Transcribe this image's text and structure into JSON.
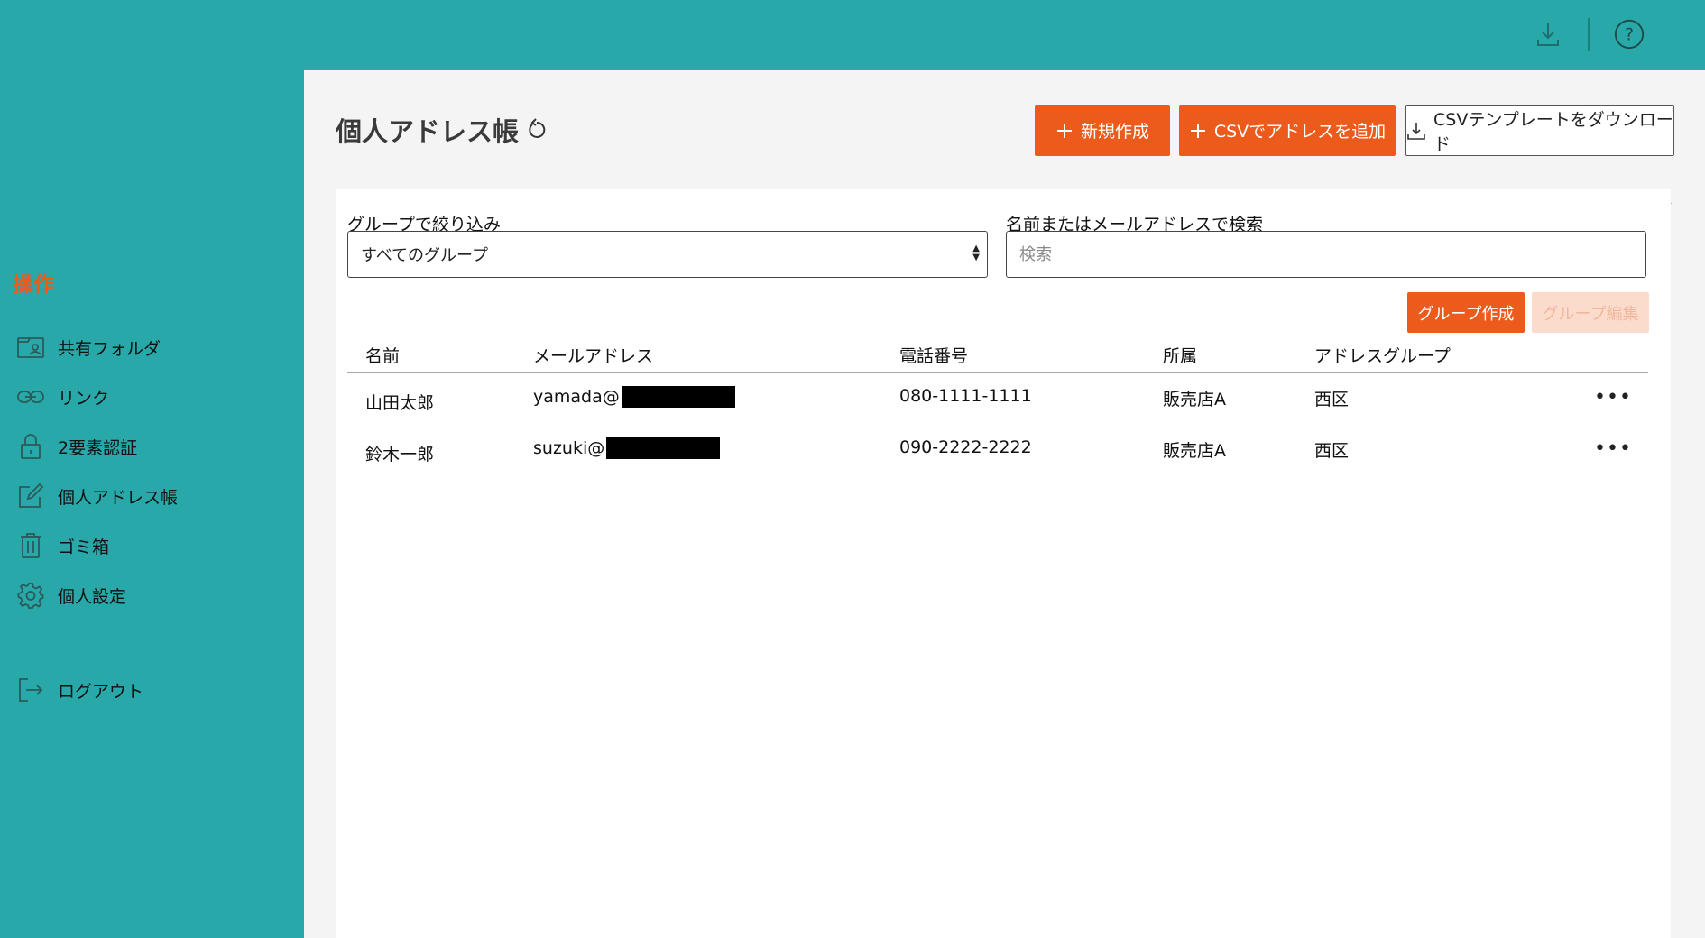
{
  "topbar": {
    "icons": [
      "download-icon",
      "help-icon"
    ],
    "help_glyph": "?"
  },
  "sidebar": {
    "section_title": "操作",
    "items": [
      {
        "label": "共有フォルダ",
        "icon": "folder-user-icon"
      },
      {
        "label": "リンク",
        "icon": "link-icon"
      },
      {
        "label": "2要素認証",
        "icon": "lock-icon"
      },
      {
        "label": "個人アドレス帳",
        "icon": "edit-icon"
      },
      {
        "label": "ゴミ箱",
        "icon": "trash-icon"
      },
      {
        "label": "個人設定",
        "icon": "gear-icon"
      },
      {
        "label": "ログアウト",
        "icon": "logout-icon"
      }
    ]
  },
  "header": {
    "title": "個人アドレス帳",
    "buttons": {
      "new": "新規作成",
      "csv_add": "CSVでアドレスを追加",
      "csv_template": "CSVテンプレートをダウンロード"
    }
  },
  "filters": {
    "group_label": "グループで絞り込み",
    "group_selected": "すべてのグループ",
    "search_label": "名前またはメールアドレスで検索",
    "search_placeholder": "検索"
  },
  "group_buttons": {
    "create": "グループ作成",
    "edit": "グループ編集"
  },
  "table": {
    "columns": [
      "名前",
      "メールアドレス",
      "電話番号",
      "所属",
      "アドレスグループ"
    ],
    "rows": [
      {
        "name": "山田太郎",
        "email_prefix": "yamada@",
        "phone": "080-1111-1111",
        "affiliation": "販売店A",
        "group": "西区",
        "more": "•••"
      },
      {
        "name": "鈴木一郎",
        "email_prefix": "suzuki@",
        "phone": "090-2222-2222",
        "affiliation": "販売店A",
        "group": "西区",
        "more": "•••"
      }
    ]
  },
  "colors": {
    "teal": "#28a8a8",
    "accent": "#ec5a1c",
    "accent_disabled": "#fbdccc"
  }
}
